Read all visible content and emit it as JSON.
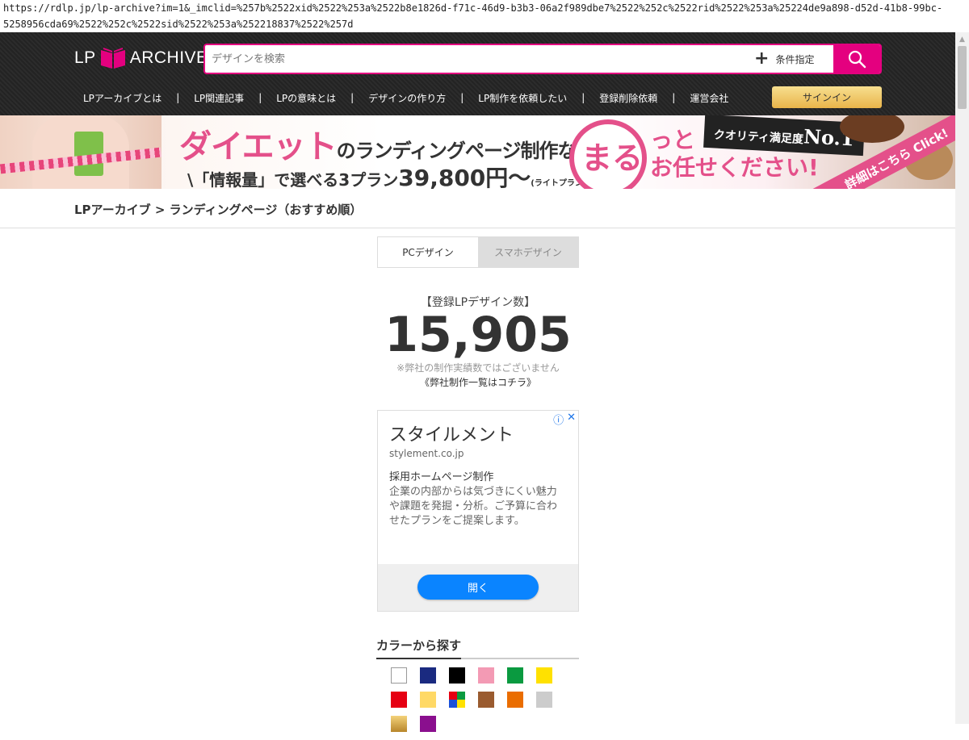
{
  "browser": {
    "url": "https://rdlp.jp/lp-archive?im=1&_imclid=%257b%2522xid%2522%253a%2522b8e1826d-f71c-46d9-b3b3-06a2f989dbe7%2522%252c%2522rid%2522%253a%25224de9a898-d52d-41b8-99bc-5258956cda69%2522%252c%2522sid%2522%253a%252218837%2522%257d"
  },
  "header": {
    "logo_left": "LP",
    "logo_right": "ARCHIVE",
    "logo_icon": "book-icon",
    "search_placeholder": "デザインを検索",
    "search_value": "",
    "condition_label": "条件指定",
    "condition_icon": "plus-icon",
    "search_icon": "search-icon",
    "accent_color": "#e4007f"
  },
  "nav": {
    "items": [
      "LPアーカイブとは",
      "LP関連記事",
      "LPの意味とは",
      "デザインの作り方",
      "LP制作を依頼したい",
      "登録削除依頼",
      "運営会社"
    ],
    "separator": "|",
    "signin_label": "サインイン"
  },
  "banner": {
    "headline_main": "ダイエット",
    "headline_sub": "のランディングページ制作なら!",
    "plan_text": "\\「情報量」で選べる3プラン",
    "price": "39,800円〜",
    "price_note": "(ライトプラン)",
    "maru": "まる",
    "omakase_line1": "っと",
    "omakase_line2": "お任せください!",
    "quality": "クオリティ満足度",
    "no1": "No.1",
    "click": "詳細はこちら Click!"
  },
  "breadcrumb": {
    "text": "LPアーカイブ > ランディングページ（おすすめ順）"
  },
  "tabs": [
    {
      "label": "PCデザイン",
      "active": true
    },
    {
      "label": "スマホデザイン",
      "active": false
    }
  ],
  "stats": {
    "label": "【登録LPデザイン数】",
    "count": "15,905",
    "note": "※弊社の制作実績数ではございません",
    "link": "《弊社制作一覧はコチラ》"
  },
  "ad": {
    "title": "スタイルメント",
    "domain": "stylement.co.jp",
    "headline": "採用ホームページ制作",
    "body": "企業の内部からは気づきにくい魅力や課題を発掘・分析。ご予算に合わせたプランをご提案します。",
    "button": "開く",
    "info_icon": "info-icon",
    "close_icon": "close-icon"
  },
  "colors": {
    "title": "カラーから探す",
    "swatches": [
      {
        "name": "white",
        "value": "#ffffff"
      },
      {
        "name": "navy",
        "value": "#1a2a80"
      },
      {
        "name": "black",
        "value": "#000000"
      },
      {
        "name": "pink",
        "value": "#f39ab4"
      },
      {
        "name": "green",
        "value": "#0a9a40"
      },
      {
        "name": "yellow",
        "value": "#ffe100"
      },
      {
        "name": "red",
        "value": "#e60012"
      },
      {
        "name": "beige",
        "value": "#ffd966"
      },
      {
        "name": "multi",
        "value": "multi"
      },
      {
        "name": "brown",
        "value": "#9a5b2f"
      },
      {
        "name": "orange",
        "value": "#ea6d00"
      },
      {
        "name": "gray",
        "value": "#cccccc"
      },
      {
        "name": "gold",
        "value": "gold"
      },
      {
        "name": "purple",
        "value": "#8a0f8e"
      }
    ]
  }
}
